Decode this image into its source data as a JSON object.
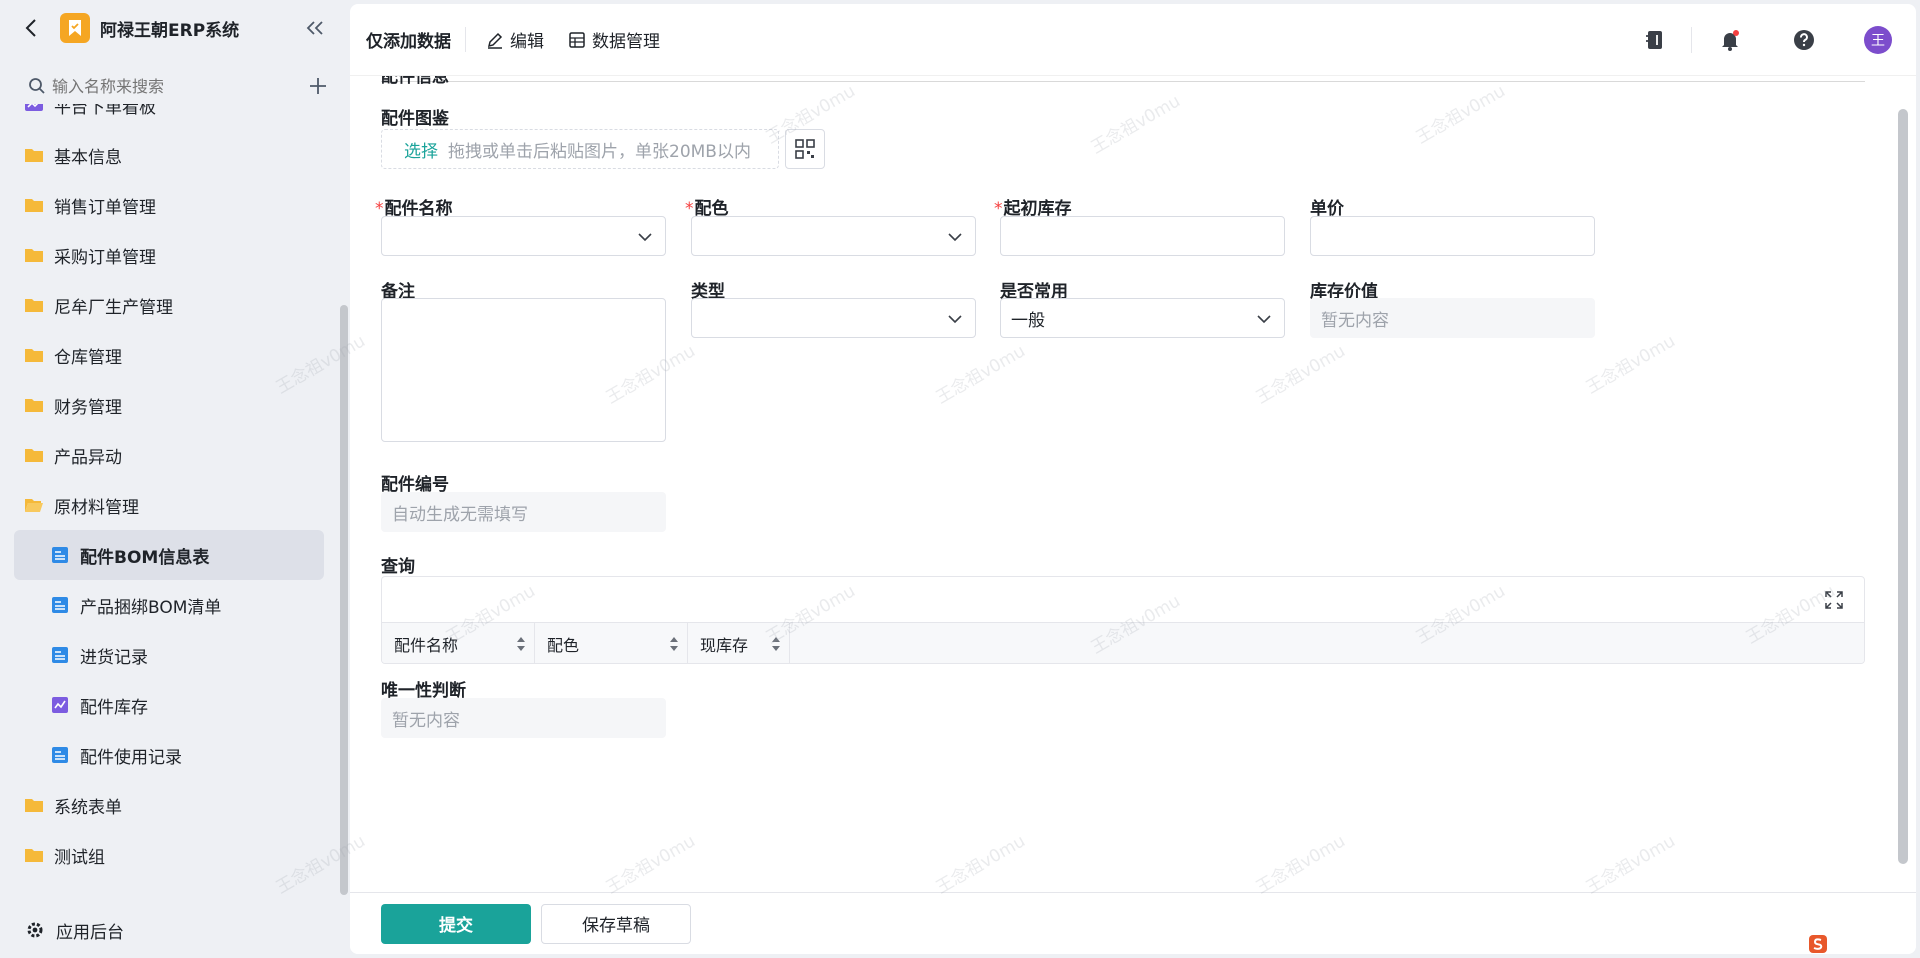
{
  "app": {
    "title": "阿禄王朝ERP系统"
  },
  "sidebar": {
    "search_placeholder": "输入名称来搜索",
    "partial_item": "平台下单看板",
    "items": [
      {
        "label": "基本信息",
        "type": "folder"
      },
      {
        "label": "销售订单管理",
        "type": "folder"
      },
      {
        "label": "采购订单管理",
        "type": "folder"
      },
      {
        "label": "尼牟厂生产管理",
        "type": "folder"
      },
      {
        "label": "仓库管理",
        "type": "folder"
      },
      {
        "label": "财务管理",
        "type": "folder"
      },
      {
        "label": "产品异动",
        "type": "folder"
      },
      {
        "label": "原材料管理",
        "type": "folder-open"
      },
      {
        "label": "配件BOM信息表",
        "type": "form",
        "active": true
      },
      {
        "label": "产品捆绑BOM清单",
        "type": "form"
      },
      {
        "label": "进货记录",
        "type": "form"
      },
      {
        "label": "配件库存",
        "type": "report"
      },
      {
        "label": "配件使用记录",
        "type": "form"
      },
      {
        "label": "系统表单",
        "type": "folder"
      },
      {
        "label": "测试组",
        "type": "folder"
      }
    ],
    "footer_label": "应用后台"
  },
  "topbar": {
    "page_title": "仅添加数据",
    "edit_label": "编辑",
    "data_manage_label": "数据管理",
    "avatar_text": "王"
  },
  "form": {
    "section_title": "配件信息",
    "image_label": "配件图鉴",
    "upload_pick": "选择",
    "upload_hint": "拖拽或单击后粘贴图片，单张20MB以内",
    "name_label": "配件名称",
    "color_label": "配色",
    "init_stock_label": "起初库存",
    "unit_price_label": "单价",
    "remark_label": "备注",
    "type_label": "类型",
    "common_label": "是否常用",
    "common_value": "一般",
    "stock_value_label": "库存价值",
    "stock_value_placeholder": "暂无内容",
    "part_no_label": "配件编号",
    "part_no_placeholder": "自动生成无需填写",
    "query_label": "查询",
    "query_columns": [
      "配件名称",
      "配色",
      "现库存"
    ],
    "unique_label": "唯一性判断",
    "unique_placeholder": "暂无内容"
  },
  "footer": {
    "submit_label": "提交",
    "draft_label": "保存草稿"
  },
  "watermark_text": "王念祖v0mu",
  "colors": {
    "accent": "#1aa39a",
    "required": "#f53f3f",
    "avatar": "#7c4dcc",
    "folder": "#f5b93a",
    "form_icon": "#2e8ae6"
  }
}
